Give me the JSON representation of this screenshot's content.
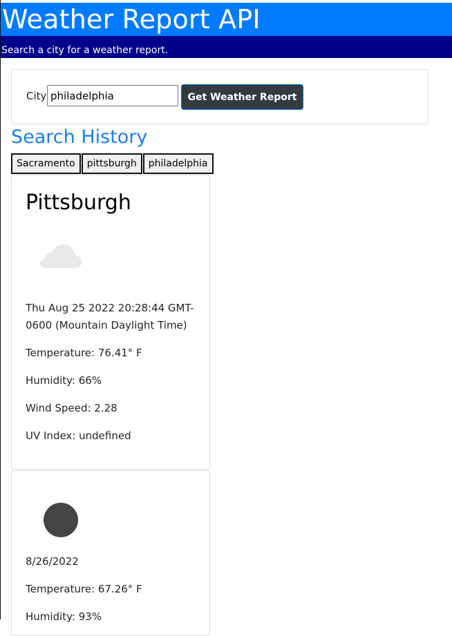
{
  "header": {
    "title": "Weather Report API",
    "subtitle": "Search a city for a weather report."
  },
  "search": {
    "label": "City",
    "value": "philadelphia",
    "button_label": "Get Weather Report"
  },
  "history": {
    "title": "Search History",
    "items": [
      "Sacramento",
      "pittsburgh",
      "philadelphia"
    ]
  },
  "current": {
    "city": "Pittsburgh",
    "icon": "cloud-icon",
    "icon_color": "#e8e8e8",
    "date": "Thu Aug 25 2022 20:28:44 GMT-0600 (Mountain Daylight Time)",
    "temperature": "Temperature: 76.41° F",
    "humidity": "Humidity: 66%",
    "wind": "Wind Speed: 2.28",
    "uv": "UV Index: undefined"
  },
  "forecast": [
    {
      "icon": "sun-icon",
      "icon_color": "#444444",
      "date": "8/26/2022",
      "temperature": "Temperature: 67.26° F",
      "humidity": "Humidity: 93%"
    }
  ],
  "colors": {
    "banner": "#007bff",
    "subbar": "#00008b",
    "history_title": "#1e7ee8",
    "button": "#343a40"
  }
}
